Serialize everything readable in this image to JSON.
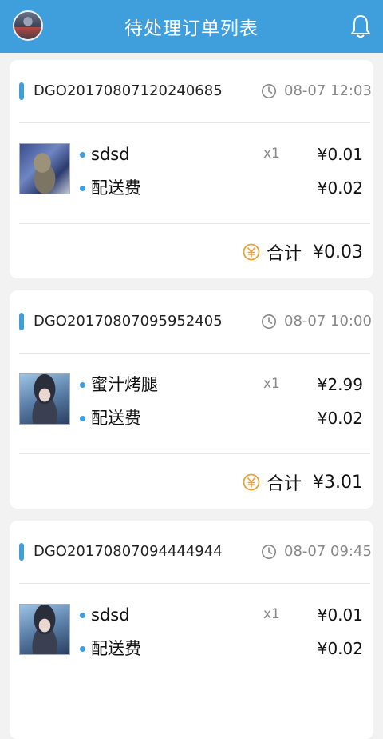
{
  "header": {
    "title": "待处理订单列表",
    "avatar_icon": "user-avatar",
    "bell_icon": "bell-icon"
  },
  "colors": {
    "brand": "#3e9fdc",
    "total_icon": "#f0a030",
    "background": "#f2f2f2"
  },
  "orders": [
    {
      "order_no": "DGO20170807120240685",
      "time": "08-07 12:03",
      "thumb": "cat",
      "items": [
        {
          "name": "sdsd",
          "qty": "x1",
          "price": "¥0.01"
        },
        {
          "name": "配送费",
          "qty": "",
          "price": "¥0.02"
        }
      ],
      "total_label": "合计",
      "total": "¥0.03"
    },
    {
      "order_no": "DGO20170807095952405",
      "time": "08-07 10:00",
      "thumb": "anime",
      "items": [
        {
          "name": "蜜汁烤腿",
          "qty": "x1",
          "price": "¥2.99"
        },
        {
          "name": "配送费",
          "qty": "",
          "price": "¥0.02"
        }
      ],
      "total_label": "合计",
      "total": "¥3.01"
    },
    {
      "order_no": "DGO20170807094444944",
      "time": "08-07 09:45",
      "thumb": "anime",
      "items": [
        {
          "name": "sdsd",
          "qty": "x1",
          "price": "¥0.01"
        },
        {
          "name": "配送费",
          "qty": "",
          "price": "¥0.02"
        }
      ],
      "total_label": "合计",
      "total": ""
    }
  ]
}
